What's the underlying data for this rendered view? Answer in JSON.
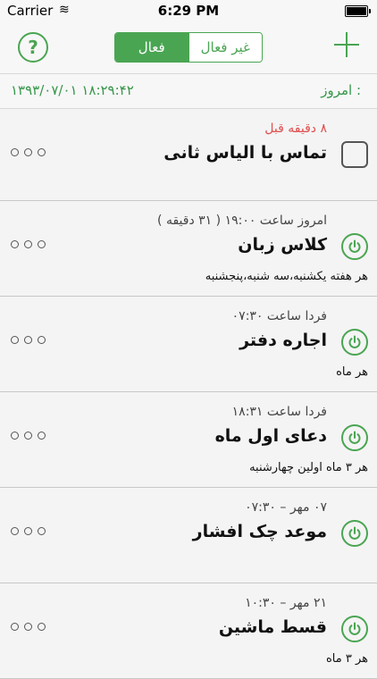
{
  "status_bar": {
    "carrier": "Carrier",
    "time": "6:29 PM"
  },
  "nav": {
    "segments": {
      "inactive": "غیر فعال",
      "active": "فعال"
    }
  },
  "date_bar": {
    "label": "امروز :",
    "value": "۱۳۹۳/۰۷/۰۱   ۱۸:۲۹:۴۲"
  },
  "colors": {
    "accent": "#4aa552",
    "overdue": "#e04c4c"
  },
  "reminders": [
    {
      "time": "۸ دقیقه قبل",
      "title": "تماس با الیاس ثانی",
      "repeat": "",
      "icon": "checkbox-icon"
    },
    {
      "time": "امروز ساعت ۱۹:۰۰ ( ۳۱ دقیقه )",
      "title": "کلاس زبان",
      "repeat": "هر هفته یکشنبه،سه شنبه،پنجشنبه",
      "icon": "power-icon"
    },
    {
      "time": "فردا ساعت ۰۷:۳۰",
      "title": "اجاره دفتر",
      "repeat": "هر ماه",
      "icon": "power-icon"
    },
    {
      "time": "فردا ساعت ۱۸:۳۱",
      "title": "دعای اول ماه",
      "repeat": "هر ۳ ماه اولین چهارشنبه",
      "icon": "power-icon"
    },
    {
      "time": "۰۷ مهر – ۰۷:۳۰",
      "title": "موعد چک افشار",
      "repeat": "",
      "icon": "power-icon"
    },
    {
      "time": "۲۱ مهر – ۱۰:۳۰",
      "title": "قسط ماشین",
      "repeat": "هر ۳ ماه",
      "icon": "power-icon"
    }
  ]
}
